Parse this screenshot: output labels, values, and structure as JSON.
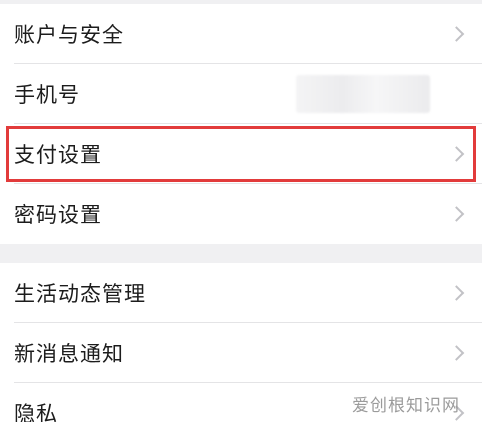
{
  "group1": {
    "items": [
      {
        "label": "账户与安全",
        "has_chevron": true
      },
      {
        "label": "手机号",
        "has_chevron": false
      },
      {
        "label": "支付设置",
        "has_chevron": true
      },
      {
        "label": "密码设置",
        "has_chevron": true
      }
    ]
  },
  "group2": {
    "items": [
      {
        "label": "生活动态管理",
        "has_chevron": true
      },
      {
        "label": "新消息通知",
        "has_chevron": true
      },
      {
        "label": "隐私",
        "has_chevron": true
      }
    ]
  },
  "highlight": {
    "target": "支付设置",
    "color": "#e23b3b"
  },
  "watermark": {
    "text": "爱创根知识网"
  },
  "icons": {
    "chevron": "chevron-right-icon"
  }
}
